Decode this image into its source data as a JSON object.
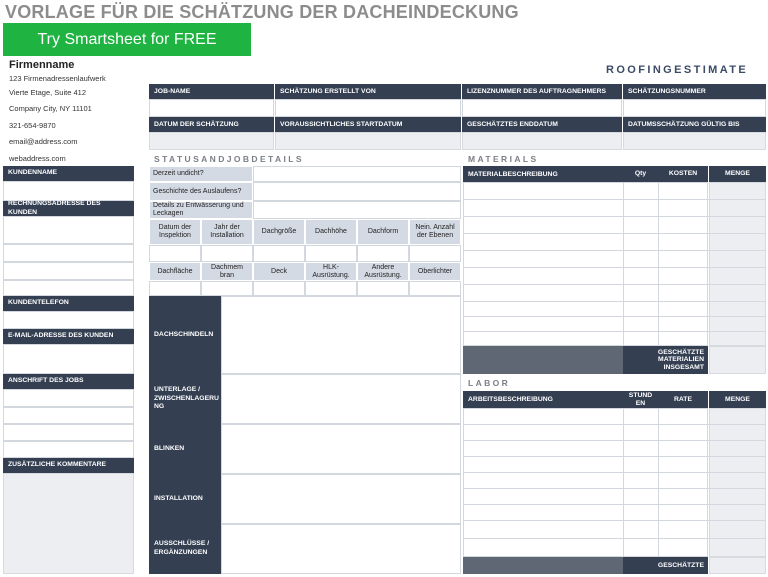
{
  "title": "VORLAGE FÜR DIE SCHÄTZUNG DER DACHEINDECKUNG",
  "cta_label": "Try Smartsheet for FREE",
  "company": {
    "name": "Firmenname",
    "lines": [
      "123 Firmenadressenlaufwerk",
      "Vierte Etage, Suite 412",
      "Company City, NY 11101",
      "321-654-9870",
      "email@address.com",
      "webaddress.com"
    ]
  },
  "brand": "ROOFINGESTIMATE",
  "top_headers_row1": [
    "JOB-NAME",
    "SCHÄTZUNG ERSTELLT VON",
    "LIZENZNUMMER DES AUFTRAGNEHMERS",
    "SCHÄTZUNGSNUMMER"
  ],
  "top_headers_row2": [
    "DATUM DER SCHÄTZUNG",
    "VORAUSSICHTLICHES STARTDATUM",
    "GESCHÄTZTES ENDDATUM",
    "DATUMSSCHÄTZUNG GÜLTIG BIS"
  ],
  "left_labels": {
    "customer_name": "KUNDENNAME",
    "billing_address": "RECHNUNGSADRESSE DES KUNDEN",
    "customer_phone": "KUNDENTELEFON",
    "customer_email": "E-MAIL-ADRESSE DES KUNDEN",
    "job_address": "ANSCHRIFT DES JOBS",
    "comments": "ZUSÄTZLICHE KOMMENTARE"
  },
  "status": {
    "section_title": "STATUSANDJOBDETAILS",
    "questions": [
      "Derzeit undicht?",
      "Geschichte des Auslaufens?",
      "Details zu Entwässerung und Leckagen"
    ],
    "row_a": [
      "Datum der Inspektion",
      "Jahr der Installation",
      "Dachgröße",
      "Dachhöhe",
      "Dachform",
      "Nein. Anzahl der Ebenen"
    ],
    "row_b": [
      "Dachfläche",
      "Dachmem bran",
      "Deck",
      "HLK-Ausrüstung.",
      "Andere Ausrüstung.",
      "Oberlichter"
    ],
    "blocks": [
      "DACHSCHINDELN",
      "UNTERLAGE / ZWISCHENLAGERU NG",
      "BLINKEN",
      "INSTALLATION",
      "AUSSCHLÜSSE / ERGÄNZUNGEN"
    ]
  },
  "materials": {
    "section_title": "MATERIALS",
    "headers": [
      "MATERIALBESCHREIBUNG",
      "Qty",
      "KOSTEN",
      "MENGE"
    ],
    "total_label": "GESCHÄTZTE MATERIALIEN INSGESAMT"
  },
  "labor": {
    "section_title": "LABOR",
    "headers": [
      "ARBEITSBESCHREIBUNG",
      "STUND EN",
      "RATE",
      "MENGE"
    ],
    "total_label": "GESCHÄTZTE"
  }
}
